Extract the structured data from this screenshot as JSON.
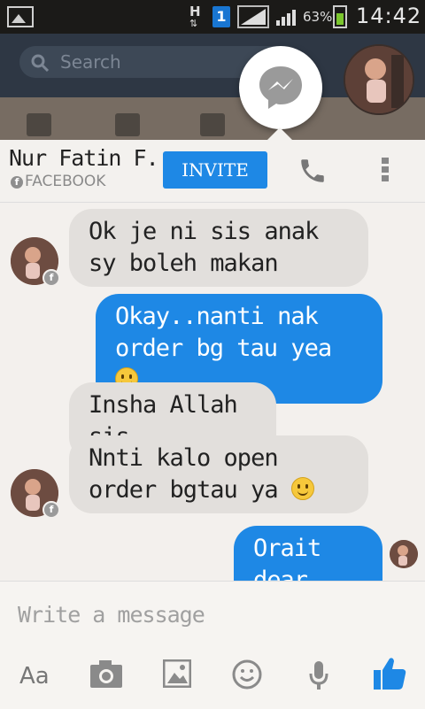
{
  "status_bar": {
    "network": "H",
    "sim": "1",
    "battery_percent": "63%",
    "time": "14:42"
  },
  "background_app": {
    "search_placeholder": "Search"
  },
  "chat": {
    "contact_name": "Nur Fatin F...",
    "contact_source": "FACEBOOK",
    "invite_label": "INVITE",
    "messages": [
      {
        "from": "them",
        "text": "Ok je ni sis anak sy boleh makan"
      },
      {
        "from": "me",
        "text": "Okay..nanti nak order bg tau yea",
        "emoji": "smile"
      },
      {
        "from": "them",
        "text": "Insha Allah sis"
      },
      {
        "from": "them",
        "text": "Nnti kalo open order bgtau ya",
        "emoji": "wink"
      },
      {
        "from": "me",
        "text": "Orait dear"
      }
    ]
  },
  "composer": {
    "placeholder": "Write a message",
    "aa_label": "Aa",
    "tools": [
      "text-format-icon",
      "camera-icon",
      "image-icon",
      "emoji-icon",
      "microphone-icon",
      "like-icon"
    ]
  },
  "colors": {
    "accent": "#1e88e5",
    "incoming_bubble": "#e2dfdc",
    "status_bar": "#1b1a18"
  }
}
